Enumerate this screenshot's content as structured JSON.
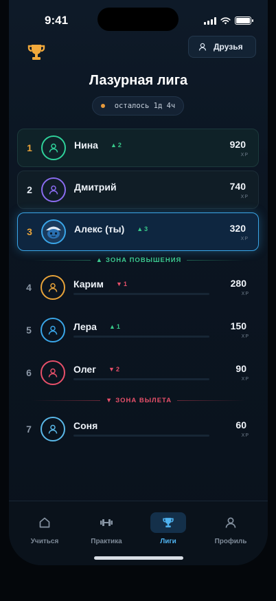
{
  "status_bar": {
    "time": "9:41"
  },
  "header": {
    "trophy_icon": "trophy-icon",
    "friends_label": "Друзья",
    "title": "Лазурная лига",
    "timer_text": "осталось 1д 4ч",
    "timer_dot_color": "#e89a3c"
  },
  "leaderboard": [
    {
      "rank": "1",
      "name": "Нина",
      "delta": "2",
      "delta_dir": "up",
      "xp": "920",
      "xp_unit": "XP",
      "color": "#2fd19a",
      "style": "promo-card"
    },
    {
      "rank": "2",
      "name": "Дмитрий",
      "delta": "",
      "delta_dir": "",
      "xp": "740",
      "xp_unit": "XP",
      "color": "#8a6cf0",
      "style": "promo-card"
    },
    {
      "rank": "3",
      "name": "Алекс (ты)",
      "delta": "3",
      "delta_dir": "up",
      "xp": "320",
      "xp_unit": "XP",
      "color": "#3aa6e8",
      "style": "me"
    },
    {
      "rank": "4",
      "name": "Карим",
      "delta": "1",
      "delta_dir": "down",
      "xp": "280",
      "xp_unit": "XP",
      "color": "#e8a33a",
      "style": "plain"
    },
    {
      "rank": "5",
      "name": "Лера",
      "delta": "1",
      "delta_dir": "up",
      "xp": "150",
      "xp_unit": "XP",
      "color": "#3aa6e8",
      "style": "plain"
    },
    {
      "rank": "6",
      "name": "Олег",
      "delta": "2",
      "delta_dir": "down",
      "xp": "90",
      "xp_unit": "XP",
      "color": "#e8506a",
      "style": "plain"
    },
    {
      "rank": "7",
      "name": "Соня",
      "delta": "",
      "delta_dir": "",
      "xp": "60",
      "xp_unit": "XP",
      "color": "#5ab8e8",
      "style": "plain"
    }
  ],
  "zones": {
    "promotion": "ЗОНА ПОВЫШЕНИЯ",
    "demotion": "ЗОНА ВЫЛЕТА"
  },
  "tabs": [
    {
      "label": "Учиться",
      "icon": "home-icon",
      "active": false
    },
    {
      "label": "Практика",
      "icon": "dumbbell-icon",
      "active": false
    },
    {
      "label": "Лиги",
      "icon": "trophy-icon",
      "active": true
    },
    {
      "label": "Профиль",
      "icon": "profile-icon",
      "active": false
    }
  ],
  "colors": {
    "accent": "#3aa6e8",
    "promo": "#3cc98f",
    "demo": "#e8506a",
    "gold": "#e8a33a"
  }
}
